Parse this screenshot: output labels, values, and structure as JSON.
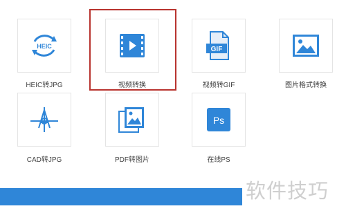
{
  "tools": [
    {
      "label": "HEIC转JPG",
      "icon": "heic-icon",
      "icon_text": "HEIC",
      "selected": false
    },
    {
      "label": "视频转换",
      "icon": "video-film-icon",
      "selected": true
    },
    {
      "label": "视频转GIF",
      "icon": "gif-file-icon",
      "icon_text": "GIF",
      "selected": false
    },
    {
      "label": "图片格式转换",
      "icon": "picture-icon",
      "selected": false
    },
    {
      "label": "CAD转JPG",
      "icon": "cad-icon",
      "selected": false
    },
    {
      "label": "PDF转图片",
      "icon": "pdf-image-icon",
      "selected": false
    },
    {
      "label": "在线PS",
      "icon": "photoshop-icon",
      "icon_text": "Ps",
      "selected": false
    }
  ],
  "watermark": "软件技巧",
  "colors": {
    "accent": "#2f86d8",
    "highlight": "#b8332e",
    "icon_blue": "#2f86d8"
  }
}
